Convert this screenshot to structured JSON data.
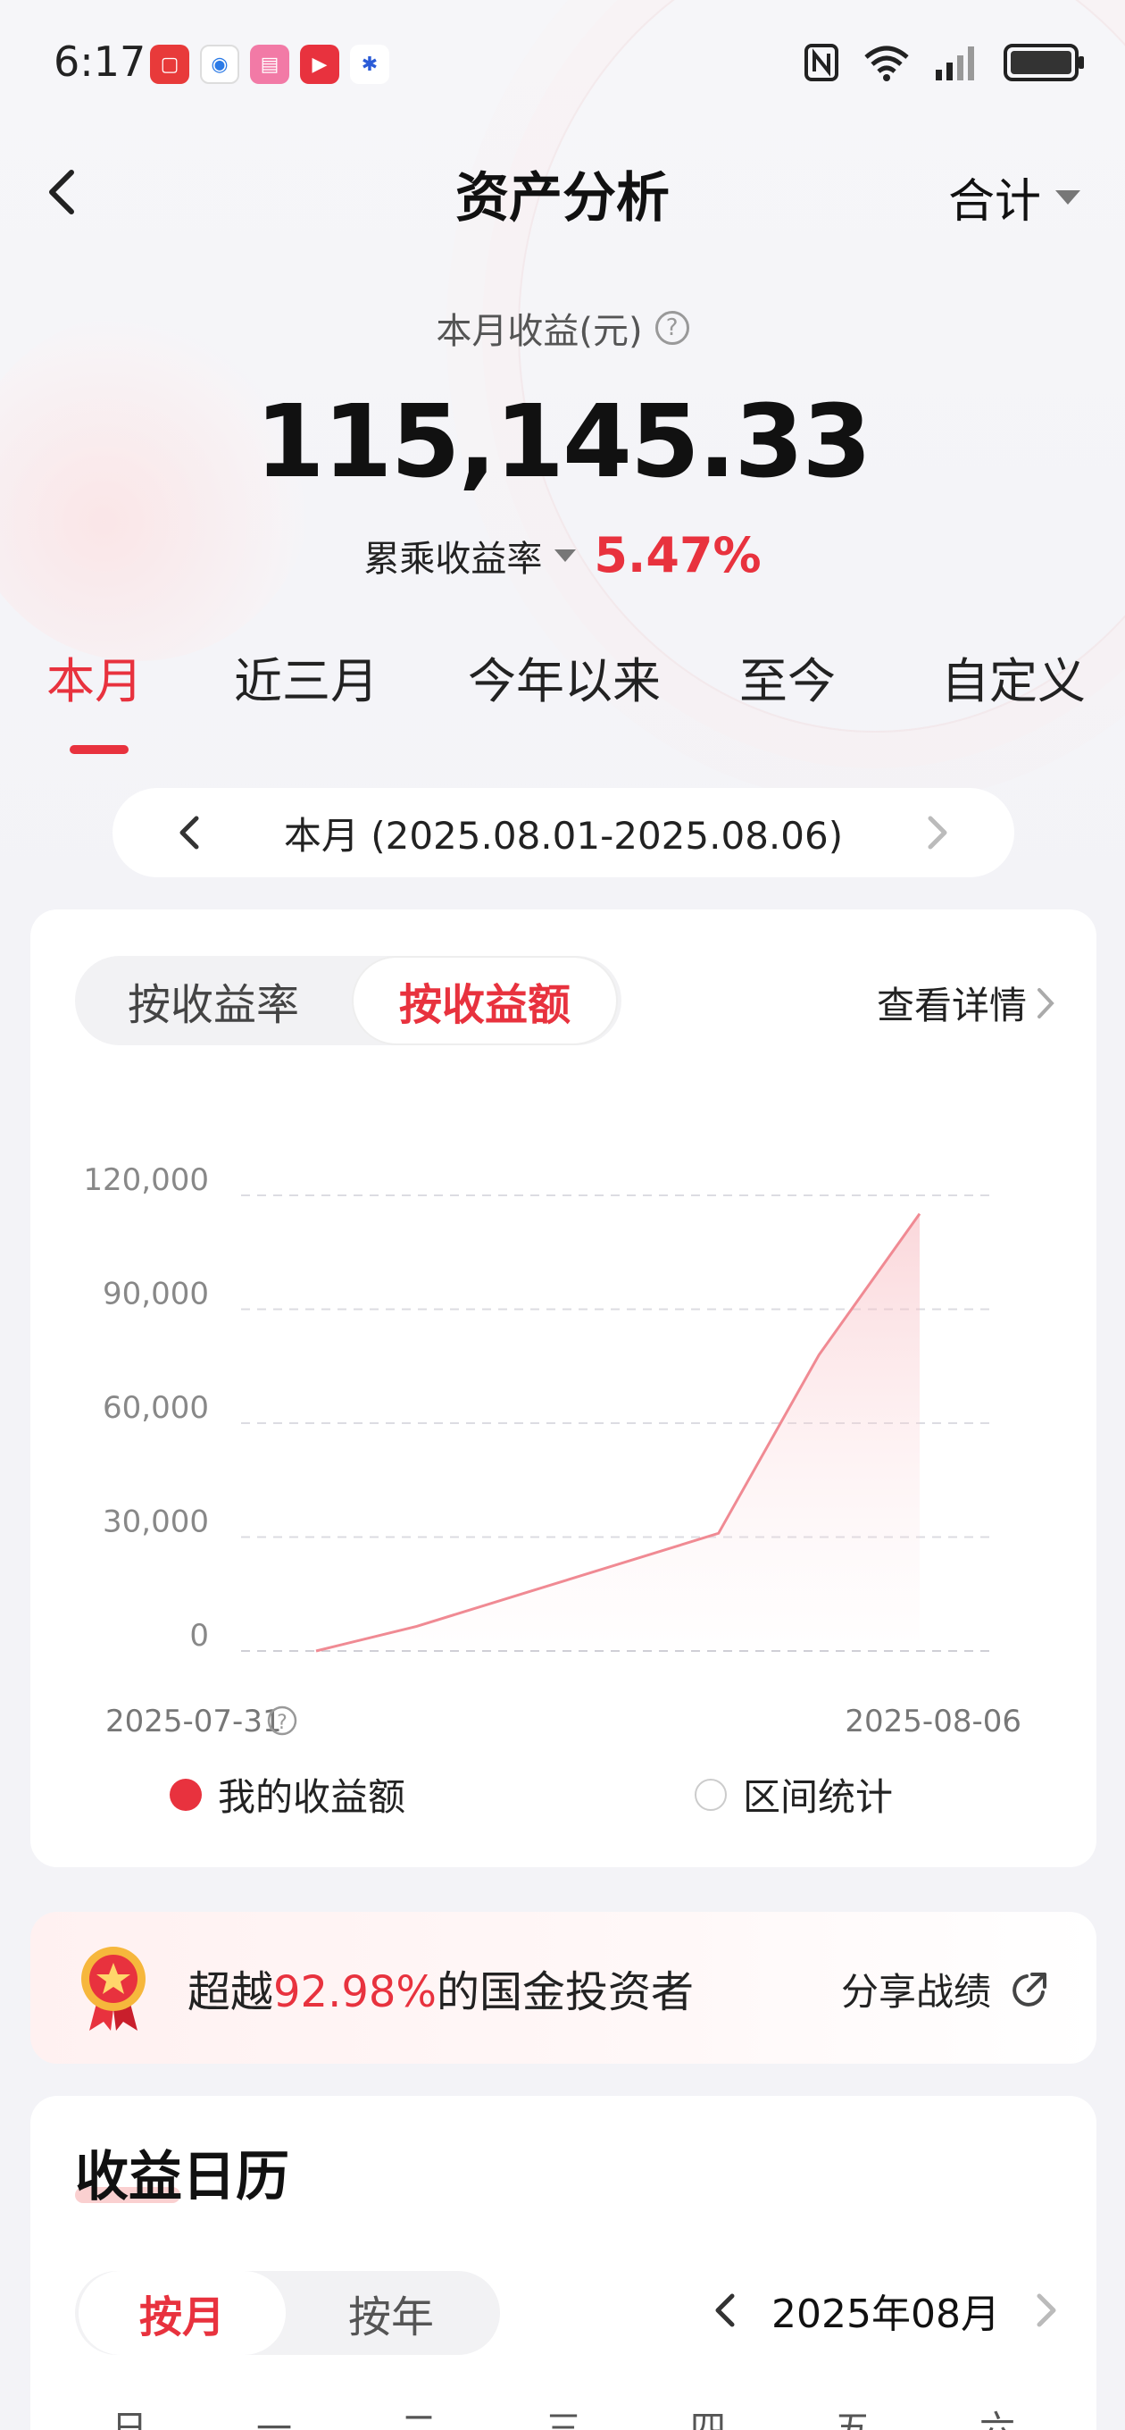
{
  "status_bar": {
    "time": "6:17"
  },
  "header": {
    "title": "资产分析",
    "filter_label": "合计"
  },
  "summary": {
    "earnings_label": "本月收益(元)",
    "earnings_value": "115,145.33",
    "rate_label": "累乘收益率",
    "rate_value": "5.47%"
  },
  "period_tabs": [
    {
      "label": "本月",
      "active": true
    },
    {
      "label": "近三月",
      "active": false
    },
    {
      "label": "今年以来",
      "active": false
    },
    {
      "label": "至今",
      "active": false
    },
    {
      "label": "自定义",
      "active": false
    }
  ],
  "date_range": "本月 (2025.08.01-2025.08.06)",
  "chart_card": {
    "segment": {
      "by_rate": "按收益率",
      "by_amount": "按收益额"
    },
    "detail_link": "查看详情",
    "legend": {
      "my_earnings": "我的收益额",
      "interval_stats": "区间统计"
    }
  },
  "chart_data": {
    "type": "area",
    "x": [
      "2025-07-31",
      "2025-08-01",
      "2025-08-04",
      "2025-08-05",
      "2025-08-06"
    ],
    "x_labels_shown": [
      "2025-07-31",
      "2025-08-06"
    ],
    "series": [
      {
        "name": "我的收益额",
        "values": [
          0,
          6500,
          31000,
          78000,
          115145.33
        ],
        "color": "#f08a93"
      }
    ],
    "y_ticks": [
      "0",
      "30,000",
      "60,000",
      "90,000",
      "120,000"
    ],
    "ylim": [
      0,
      120000
    ],
    "grid": true
  },
  "rank": {
    "prefix": "超越",
    "percent": "92.98%",
    "suffix": "的国金投资者",
    "share_label": "分享战绩"
  },
  "calendar": {
    "title": "收益日历",
    "tab_month": "按月",
    "tab_year": "按年",
    "month_label": "2025年08月",
    "weekdays": [
      "日",
      "一",
      "二",
      "三",
      "四",
      "五",
      "六"
    ]
  },
  "colors": {
    "accent": "#e8323e",
    "background": "#f3f3f7"
  }
}
